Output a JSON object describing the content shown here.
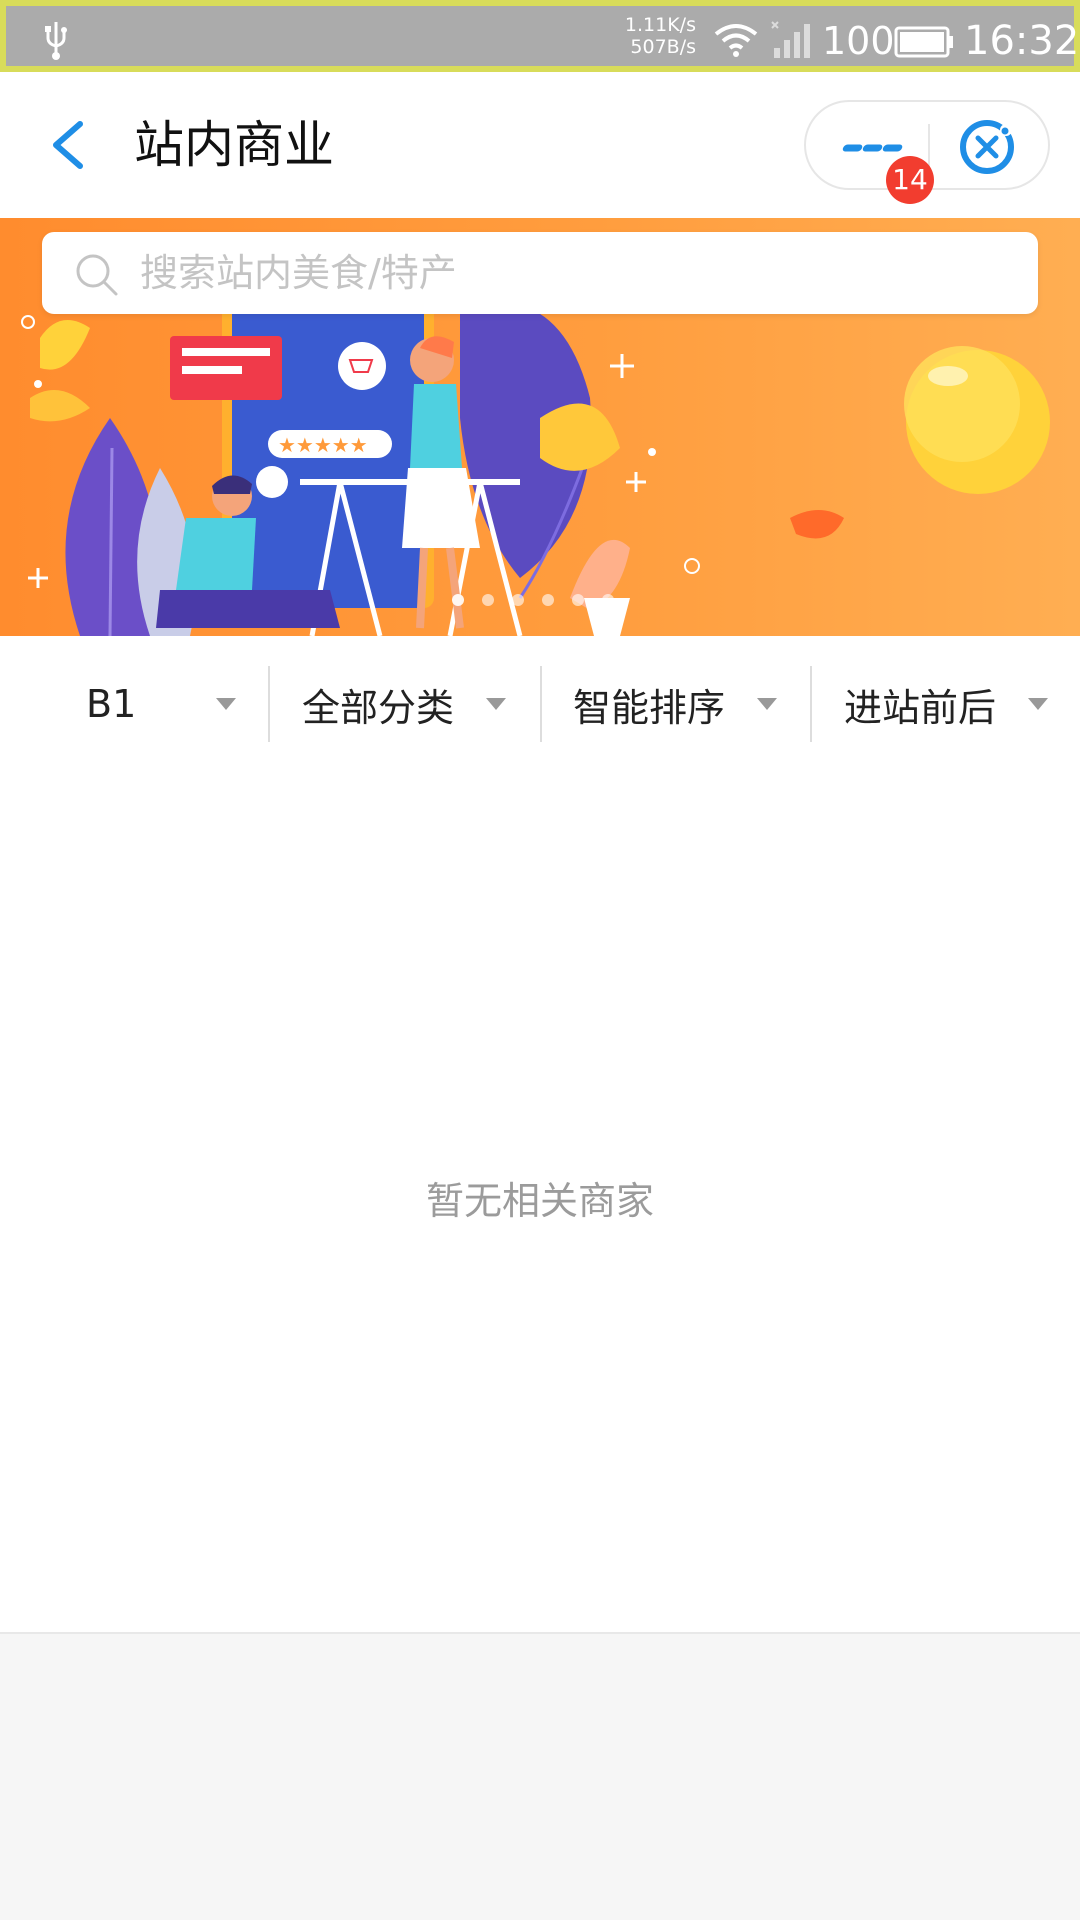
{
  "status_bar": {
    "net_up": "1.11K/s",
    "net_down": "507B/s",
    "battery": "100",
    "time": "16:32"
  },
  "header": {
    "title": "站内商业",
    "badge_count": "14"
  },
  "search": {
    "placeholder": "搜索站内美食/特产"
  },
  "filters": [
    {
      "label": "B1"
    },
    {
      "label": "全部分类"
    },
    {
      "label": "智能排序"
    },
    {
      "label": "进站前后"
    }
  ],
  "empty_state": {
    "message": "暂无相关商家"
  },
  "colors": {
    "accent": "#1f8ee6",
    "badge": "#f23d2f",
    "banner_orange": "#ff9a3a"
  },
  "icons": [
    "usb-icon",
    "wifi-icon",
    "signal-icon",
    "battery-icon",
    "back-arrow-icon",
    "more-dots-icon",
    "close-circle-icon",
    "search-icon",
    "caret-down-icon"
  ]
}
